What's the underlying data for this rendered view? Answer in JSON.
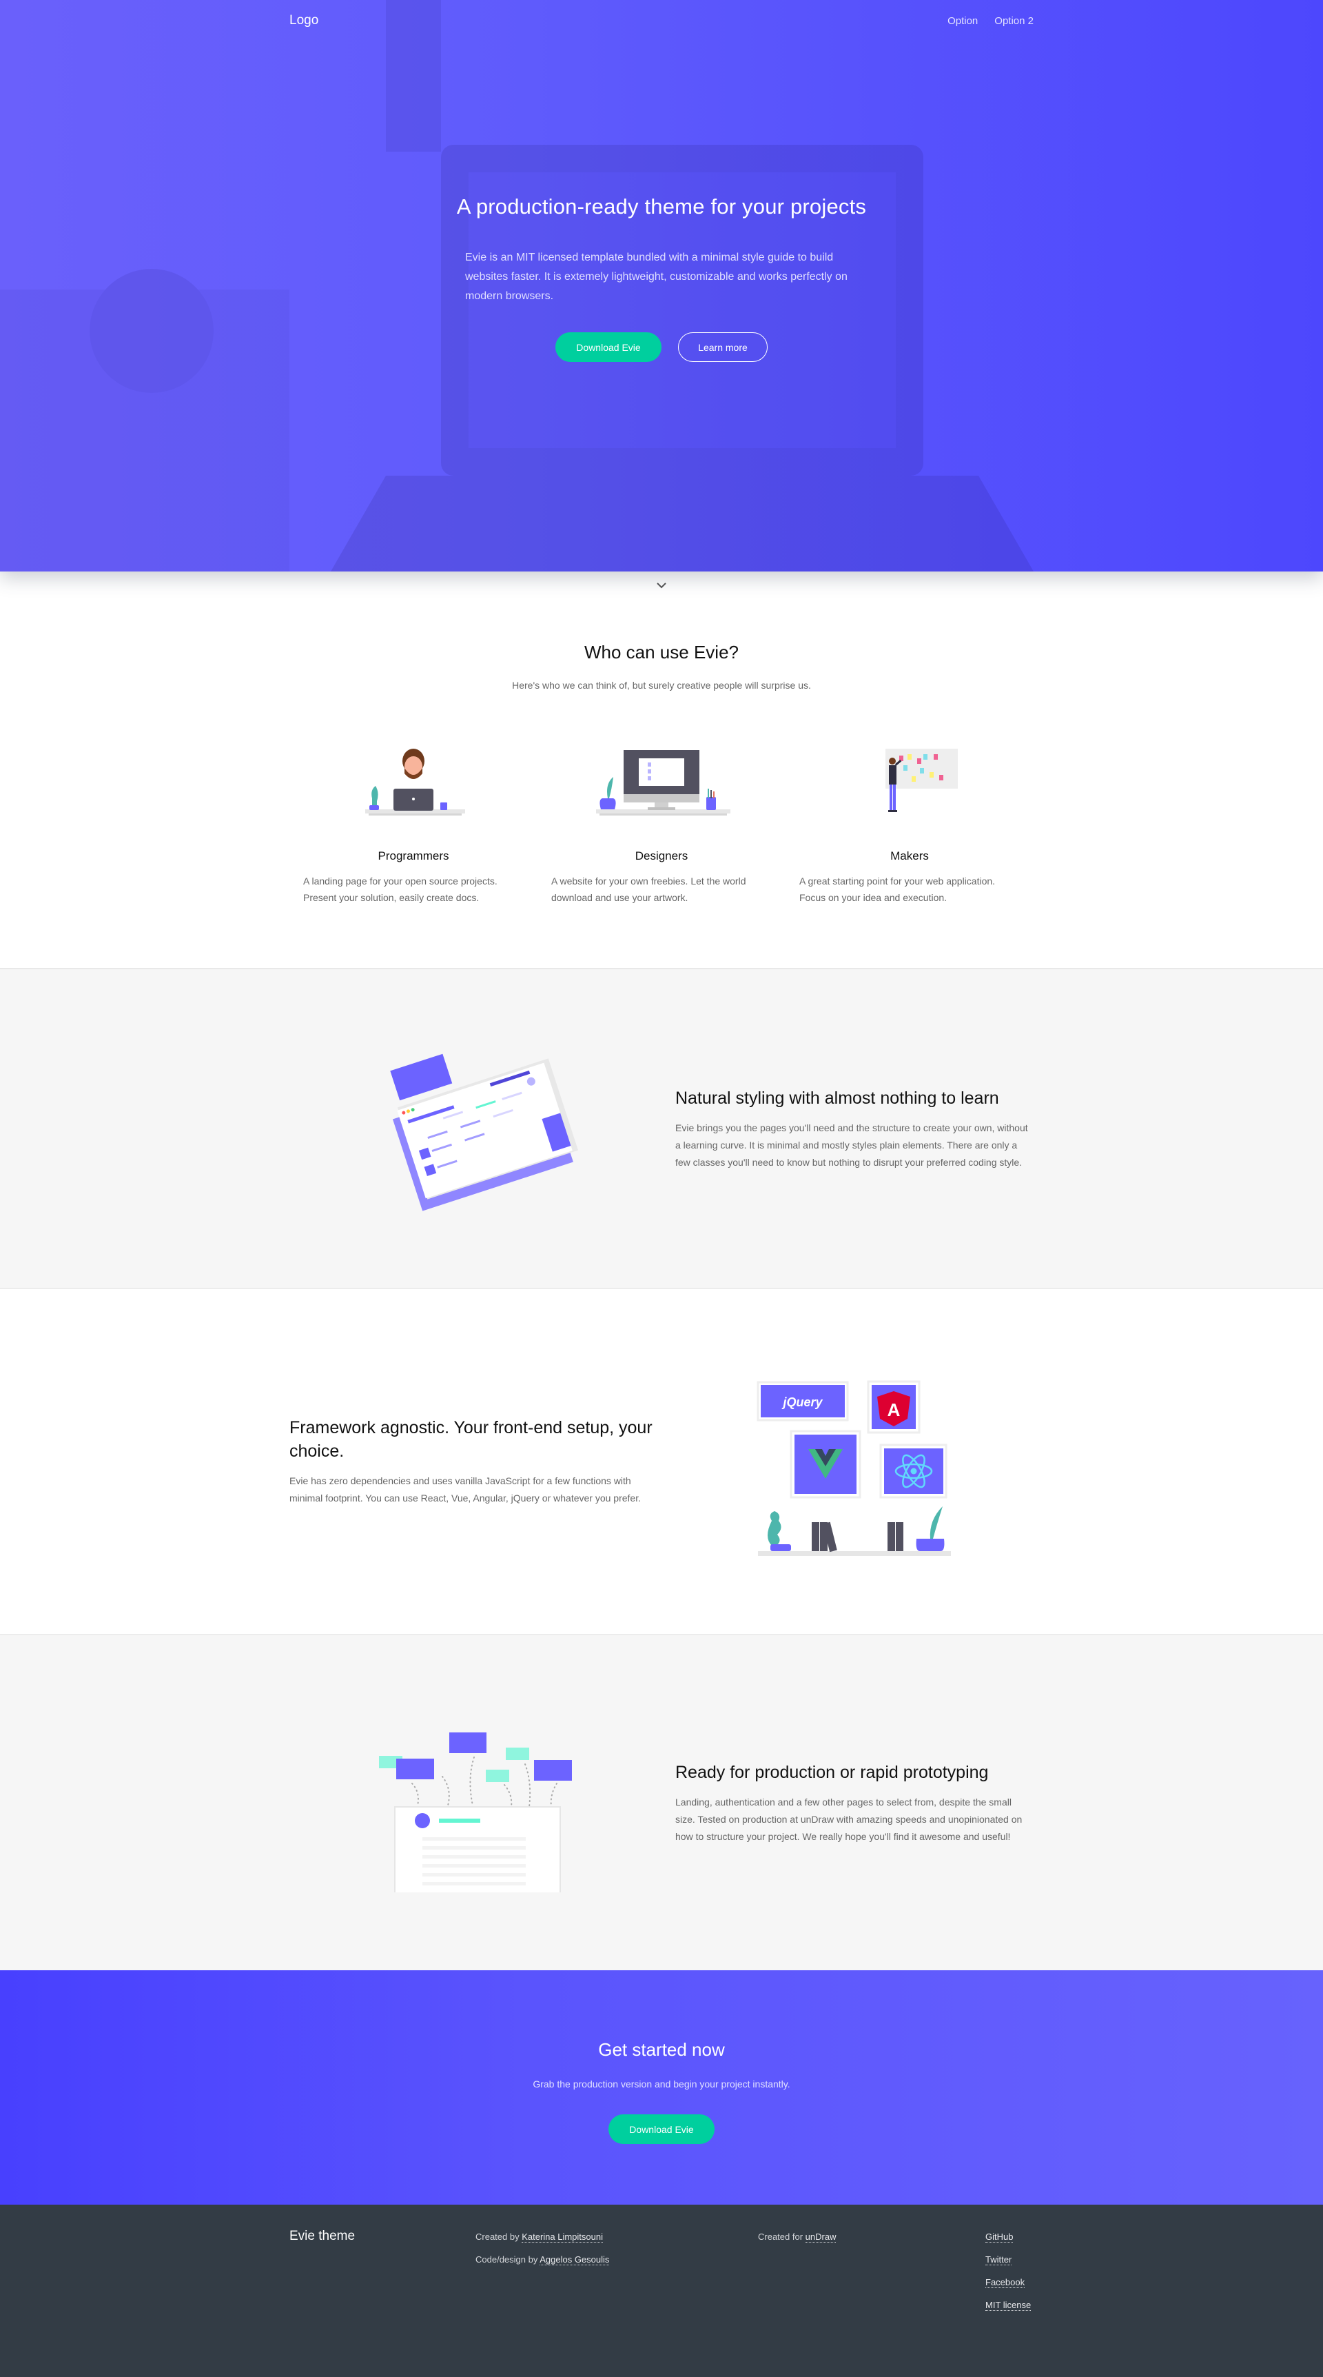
{
  "nav": {
    "logo": "Logo",
    "links": [
      "Option",
      "Option 2"
    ]
  },
  "hero": {
    "title": "A production-ready theme for your projects",
    "text": "Evie is an MIT licensed template bundled with a minimal style guide to build websites faster. It is extemely lightweight, customizable and works perfectly on modern browsers.",
    "primary_button": "Download Evie",
    "secondary_button": "Learn more"
  },
  "who": {
    "title": "Who can use Evie?",
    "subtitle": "Here's who we can think of, but surely creative people will surprise us.",
    "cards": [
      {
        "title": "Programmers",
        "text": "A landing page for your open source projects. Present your solution, easily create docs."
      },
      {
        "title": "Designers",
        "text": "A website for your own freebies. Let the world download and use your artwork."
      },
      {
        "title": "Makers",
        "text": "A great starting point for your web application. Focus on your idea and execution."
      }
    ]
  },
  "features": [
    {
      "title": "Natural styling with almost nothing to learn",
      "text": "Evie brings you the pages you'll need and the structure to create your own, without a learning curve. It is minimal and mostly styles plain elements. There are only a few classes you'll need to know but nothing to disrupt your preferred coding style."
    },
    {
      "title": "Framework agnostic. Your front-end setup, your choice.",
      "text": "Evie has zero dependencies and uses vanilla JavaScript for a few functions with minimal footprint. You can use React, Vue, Angular, jQuery or whatever you prefer."
    },
    {
      "title": "Ready for production or rapid prototyping",
      "text": "Landing, authentication and a few other pages to select from, despite the small size. Tested on production at unDraw with amazing speeds and unopinionated on how to structure your project. We really hope you'll find it awesome and useful!"
    }
  ],
  "framework_logos": {
    "jquery": "jQuery",
    "angular": "A"
  },
  "cta": {
    "title": "Get started now",
    "text": "Grab the production version and begin your project instantly.",
    "button": "Download Evie"
  },
  "footer": {
    "brand": "Evie theme",
    "created_by_prefix": "Created by ",
    "created_by_name": "Katerina Limpitsouni",
    "code_by_prefix": "Code/design by ",
    "code_by_name": "Aggelos Gesoulis",
    "created_for_prefix": "Created for ",
    "created_for_name": "unDraw",
    "links": [
      "GitHub",
      "Twitter",
      "Facebook",
      "MIT license"
    ]
  },
  "colors": {
    "brand": "#5f5bfc",
    "accent": "#00cf9e",
    "footer_bg": "#333c45",
    "grey_bg": "#f6f6f6"
  }
}
